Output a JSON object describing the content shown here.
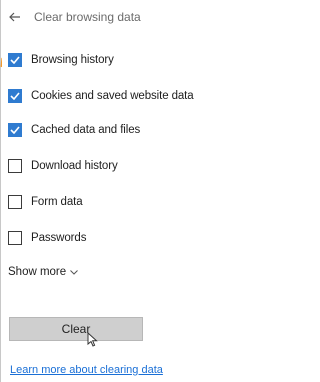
{
  "panel": {
    "title": "Clear browsing data",
    "back_icon": "back-arrow-icon"
  },
  "options": [
    {
      "label": "Browsing history",
      "checked": true
    },
    {
      "label": "Cookies and saved website data",
      "checked": true
    },
    {
      "label": "Cached data and files",
      "checked": true
    },
    {
      "label": "Download history",
      "checked": false
    },
    {
      "label": "Form data",
      "checked": false
    },
    {
      "label": "Passwords",
      "checked": false
    }
  ],
  "show_more": {
    "label": "Show more",
    "icon": "chevron-down-icon"
  },
  "clear_button": {
    "label": "Clear"
  },
  "learn_more": {
    "label": "Learn more about clearing data"
  },
  "colors": {
    "checkbox_checked": "#2f7bd0",
    "link": "#1a6fd6",
    "accent": "#f39a2b",
    "button_bg": "#cfcfcf"
  }
}
